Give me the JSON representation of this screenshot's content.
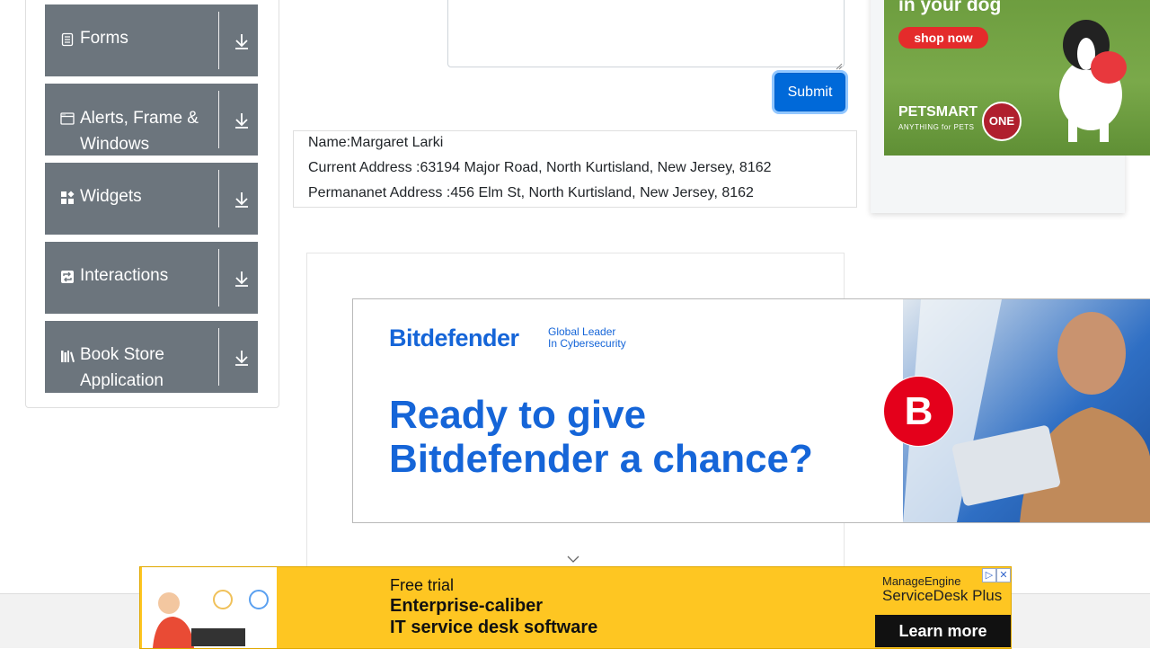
{
  "sidebar": {
    "groups": [
      {
        "label": "Forms",
        "icon": "form-icon"
      },
      {
        "label": "Alerts, Frame & Windows",
        "icon": "window-icon"
      },
      {
        "label": "Widgets",
        "icon": "widgets-icon"
      },
      {
        "label": "Interactions",
        "icon": "interactions-icon"
      },
      {
        "label": "Book Store Application",
        "icon": "books-icon"
      }
    ]
  },
  "form": {
    "submit_label": "Submit"
  },
  "output": {
    "name": "Name:Margaret Larki",
    "current_address": "Current Address :63194 Major Road, North Kurtisland, New Jersey, 8162",
    "permanent_address": "Permananet Address :456 Elm St, North Kurtisland, New Jersey, 8162"
  },
  "ads": {
    "pet": {
      "headline": "in your dog",
      "cta": "shop now",
      "brand": "PETSMART",
      "brand_tag": "ANYTHING for PETS",
      "partner": "ONE"
    },
    "bitdefender": {
      "brand": "Bitdefender",
      "tagline_line1": "Global Leader",
      "tagline_line2": "In Cybersecurity",
      "headline_line1": "Ready to give",
      "headline_line2": "Bitdefender a chance?",
      "logo_letter": "B"
    },
    "manageengine": {
      "free": "Free trial",
      "line1": "Enterprise-caliber",
      "line2": "IT service desk software",
      "brand": "ManageEngine",
      "product": "ServiceDesk Plus",
      "cta": "Learn more"
    }
  },
  "colors": {
    "sidebar_group_bg": "#6c757d",
    "submit_bg": "#0069d9",
    "bitdefender_blue": "#1565d8",
    "ad_yellow": "#fec622"
  }
}
